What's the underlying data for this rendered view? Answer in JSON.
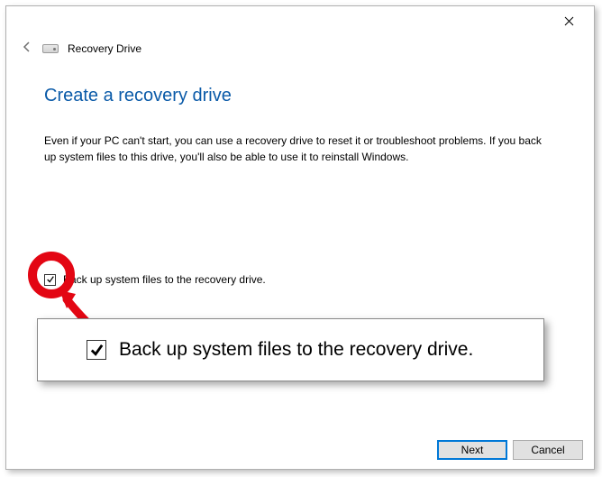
{
  "header": {
    "window_title": "Recovery Drive"
  },
  "main": {
    "title": "Create a recovery drive",
    "description": "Even if your PC can't start, you can use a recovery drive to reset it or troubleshoot problems. If you back up system files to this drive, you'll also be able to use it to reinstall Windows."
  },
  "checkbox": {
    "label": "Back up system files to the recovery drive.",
    "checked": true
  },
  "zoom": {
    "label": "Back up system files to the recovery drive."
  },
  "buttons": {
    "next": "Next",
    "cancel": "Cancel"
  }
}
